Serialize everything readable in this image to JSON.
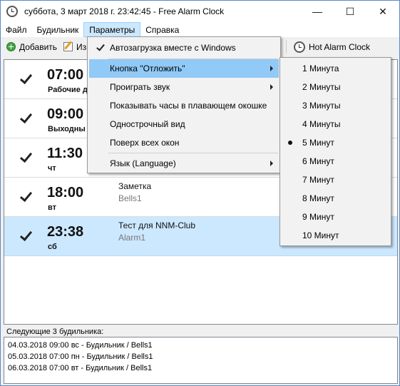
{
  "window": {
    "title": "суббота, 3 март 2018 г. 23:42:45 - Free Alarm Clock",
    "controls": {
      "minimize": "—",
      "maximize": "☐",
      "close": "✕"
    }
  },
  "menubar": {
    "items": [
      "Файл",
      "Будильник",
      "Параметры",
      "Справка"
    ],
    "active": "Параметры"
  },
  "toolbar": {
    "add_label": "Добавить",
    "edit_label_partial": "Изм",
    "hot_alarm_label": "Hot Alarm Clock"
  },
  "alarms": [
    {
      "enabled": true,
      "time": "07:00",
      "days": "Рабочие д",
      "title": "",
      "sound": ""
    },
    {
      "enabled": true,
      "time": "09:00",
      "days": "Выходны",
      "title": "",
      "sound": ""
    },
    {
      "enabled": true,
      "time": "11:30",
      "days": "чт",
      "title": "",
      "sound": ""
    },
    {
      "enabled": true,
      "time": "18:00",
      "days": "вт",
      "title": "Заметка",
      "sound": "Bells1"
    },
    {
      "enabled": true,
      "time": "23:38",
      "days": "сб",
      "title": "Тест для NNM-Club",
      "sound": "Alarm1",
      "selected": true
    }
  ],
  "next_alarms": {
    "label": "Следующие 3 будильника:",
    "lines": [
      "04.03.2018 09:00 вс - Будильник / Bells1",
      "05.03.2018 07:00 пн - Будильник / Bells1",
      "06.03.2018 07:00 вт - Будильник / Bells1"
    ]
  },
  "params_menu": {
    "items": [
      {
        "label": "Автозагрузка вместе с Windows",
        "checked": true,
        "submenu": false
      },
      {
        "label": "Кнопка \"Отложить\"",
        "checked": false,
        "submenu": true,
        "hover": true
      },
      {
        "label": "Проиграть звук",
        "checked": false,
        "submenu": true
      },
      {
        "label": "Показывать часы в плавающем окошке",
        "checked": false,
        "submenu": false
      },
      {
        "label": "Однострочный вид",
        "checked": false,
        "submenu": false
      },
      {
        "label": "Поверх всех окон",
        "checked": false,
        "submenu": false
      },
      {
        "label": "Язык (Language)",
        "checked": false,
        "submenu": true
      }
    ]
  },
  "snooze_submenu": {
    "items": [
      {
        "label": "1 Минута",
        "selected": false
      },
      {
        "label": "2 Минуты",
        "selected": false
      },
      {
        "label": "3 Минуты",
        "selected": false
      },
      {
        "label": "4 Минуты",
        "selected": false
      },
      {
        "label": "5 Минут",
        "selected": true
      },
      {
        "label": "6 Минут",
        "selected": false
      },
      {
        "label": "7 Минут",
        "selected": false
      },
      {
        "label": "8 Минут",
        "selected": false
      },
      {
        "label": "9 Минут",
        "selected": false
      },
      {
        "label": "10 Минут",
        "selected": false
      }
    ]
  }
}
